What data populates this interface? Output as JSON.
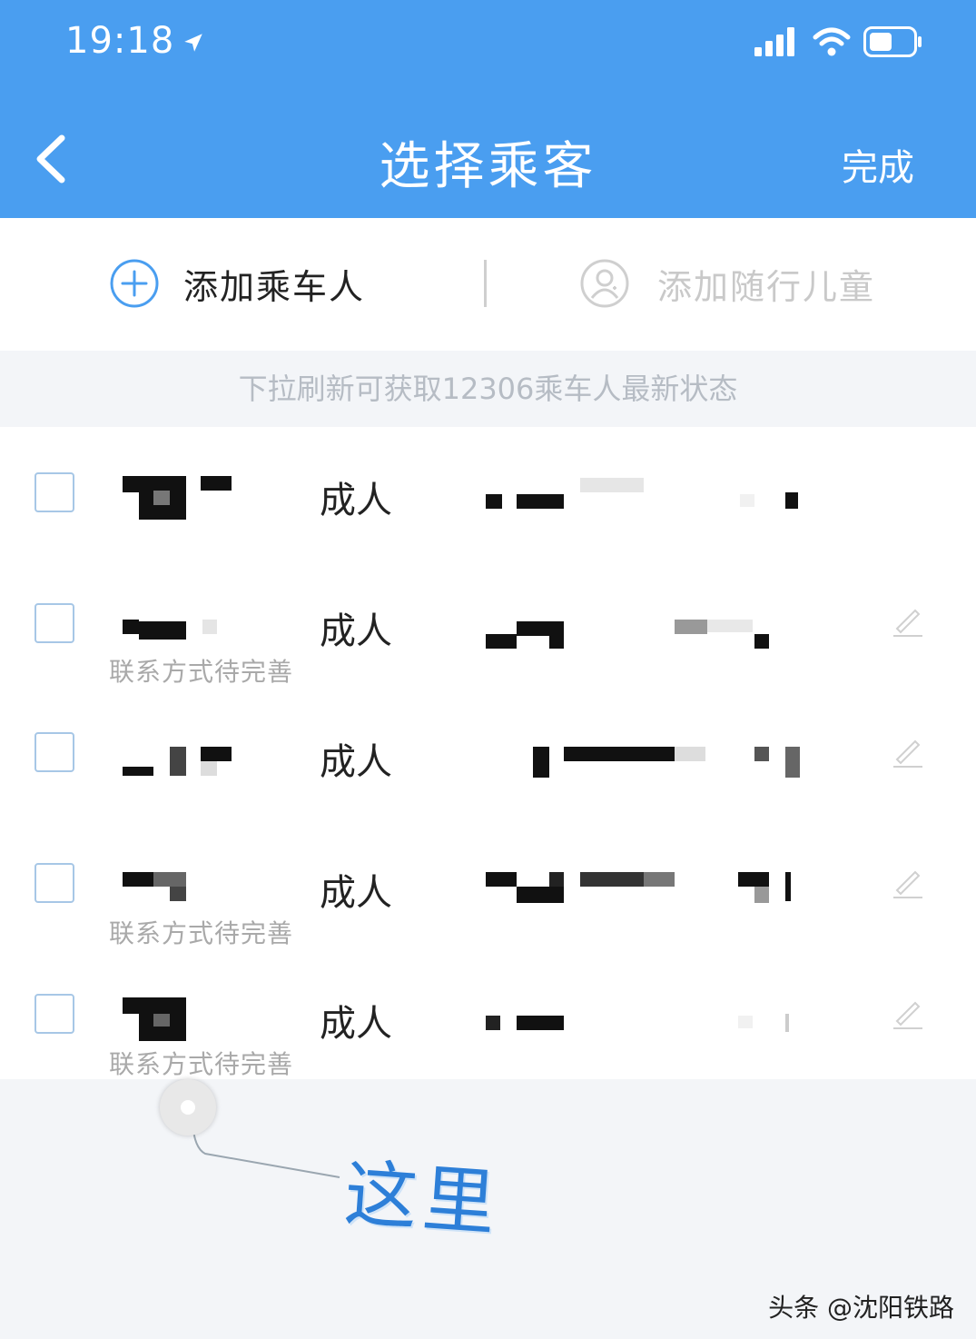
{
  "status_bar": {
    "time": "19:18",
    "icons": [
      "location-arrow-icon",
      "signal-icon",
      "wifi-icon",
      "battery-icon"
    ]
  },
  "nav": {
    "title": "选择乘客",
    "done": "完成",
    "back_icon": "chevron-left-icon"
  },
  "add_bar": {
    "add_passenger": "添加乘车人",
    "add_child": "添加随行儿童"
  },
  "tip": "下拉刷新可获取12306乘车人最新状态",
  "passengers": [
    {
      "type": "成人",
      "hint": ""
    },
    {
      "type": "成人",
      "hint": "联系方式待完善"
    },
    {
      "type": "成人",
      "hint": ""
    },
    {
      "type": "成人",
      "hint": "联系方式待完善"
    },
    {
      "type": "成人",
      "hint": "联系方式待完善"
    }
  ],
  "annotation": "这里",
  "watermark": "头条 @沈阳铁路",
  "colors": {
    "header": "#4a9ef0",
    "accent": "#2d7fd8",
    "checkbox_border": "#a7c7e6"
  }
}
